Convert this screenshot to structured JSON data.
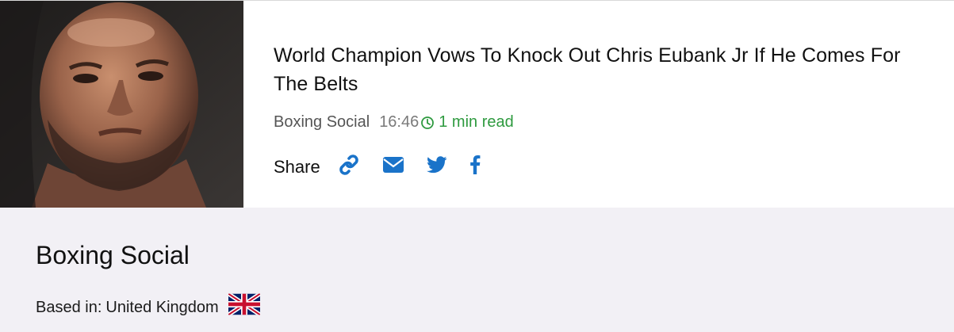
{
  "article": {
    "headline": "World Champion Vows To Knock Out Chris Eubank Jr If He Comes For The Belts",
    "source": "Boxing Social",
    "time": "16:46",
    "read_time": "1 min read",
    "thumbnail_icon": "boxer-portrait-image"
  },
  "share": {
    "label": "Share",
    "buttons": [
      {
        "icon": "link-icon"
      },
      {
        "icon": "envelope-icon"
      },
      {
        "icon": "twitter-icon"
      },
      {
        "icon": "facebook-icon"
      }
    ],
    "icon_color": "#1a73c9"
  },
  "publisher": {
    "name": "Boxing Social",
    "based_label": "Based in:",
    "country": "United Kingdom",
    "flag_icon": "uk-flag-icon"
  },
  "colors": {
    "read_time": "#2e9a3f",
    "footer_bg": "#f2f0f5"
  }
}
